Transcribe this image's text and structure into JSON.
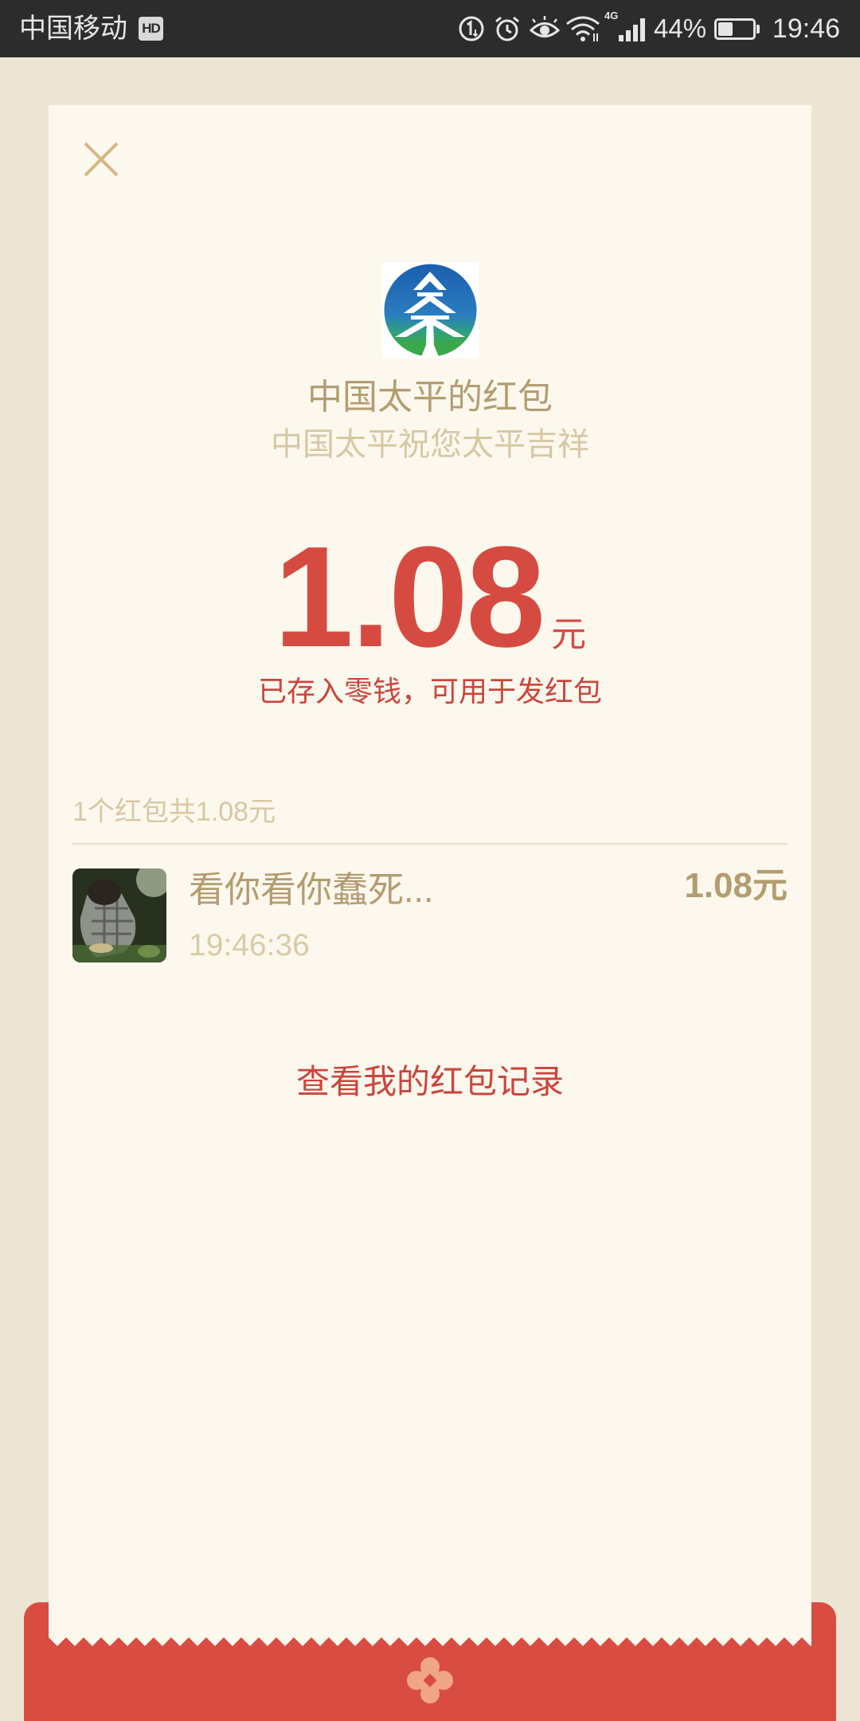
{
  "status_bar": {
    "carrier": "中国移动",
    "hd_badge": "HD",
    "network_type": "4G",
    "battery_text": "44%",
    "battery_level": 0.44,
    "time": "19:46",
    "icons": [
      "circle-one-icon",
      "alarm-icon",
      "eye-icon",
      "wifi-icon",
      "signal-icon",
      "battery-icon"
    ]
  },
  "red_packet": {
    "close_icon": "close-icon",
    "sender_logo": "china-taiping-logo",
    "sender_title": "中国太平的红包",
    "greeting": "中国太平祝您太平吉祥",
    "amount": "1.08",
    "amount_unit": "元",
    "deposit_note": "已存入零钱，可用于发红包"
  },
  "claim_list": {
    "summary": "1个红包共1.08元",
    "items": [
      {
        "name": "看你看你蠢死...",
        "time": "19:46:36",
        "amount": "1.08元",
        "avatar": "user-avatar-photo"
      }
    ]
  },
  "record_link": "查看我的红包记录",
  "envelope": {
    "emblem_icon": "flower-emblem-icon"
  },
  "colors": {
    "status_bar": "#2c2c2c",
    "page_background": "#ede5d3",
    "card_background": "#fcf8ee",
    "gold_text": "#b39d70",
    "light_gold_text": "#d7c8a3",
    "accent_red": "#d64b41",
    "envelope_red": "#d94c42",
    "emblem": "#f0a488"
  }
}
